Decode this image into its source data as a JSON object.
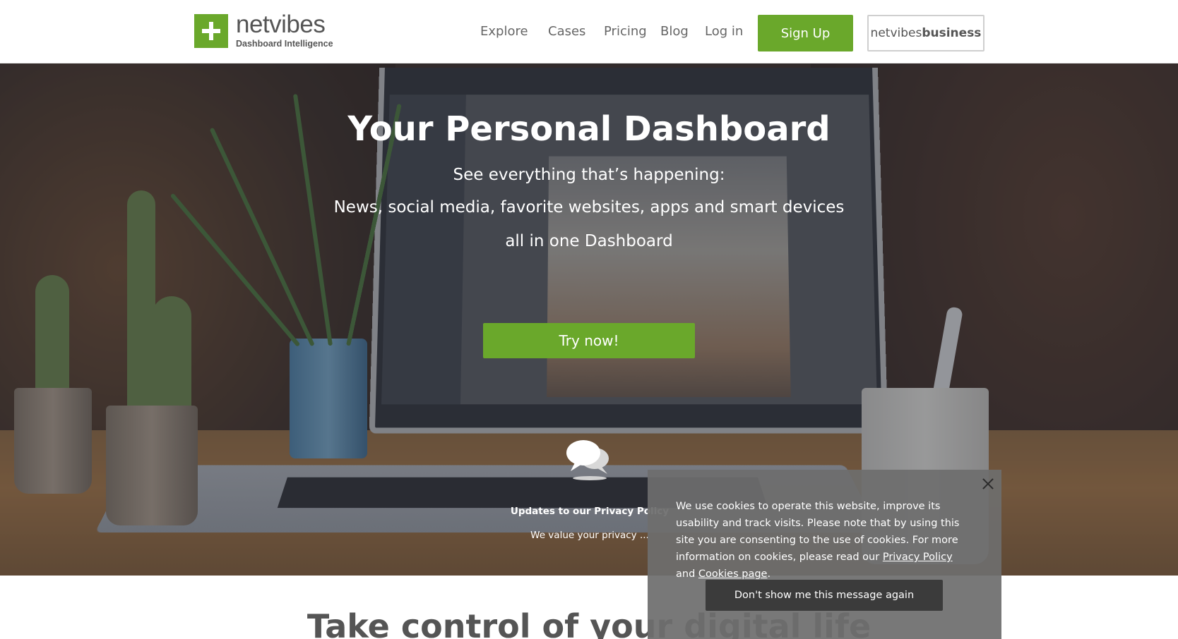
{
  "header": {
    "logo": {
      "name": "netvibes",
      "tagline": "Dashboard Intelligence"
    },
    "nav": [
      {
        "label": "Explore"
      },
      {
        "label": "Cases"
      },
      {
        "label": "Pricing"
      },
      {
        "label": "Blog"
      },
      {
        "label": "Log in"
      }
    ],
    "signup_label": "Sign Up",
    "business": {
      "prefix": "netvibes",
      "bold": "business"
    }
  },
  "hero": {
    "title": "Your Personal Dashboard",
    "subtitle_1": "See everything that’s happening:",
    "subtitle_2": "News, social media, favorite websites, apps and smart devices",
    "subtitle_3": "all in one Dashboard",
    "cta_label": "Try now!",
    "privacy_title": "Updates to our Privacy Policy",
    "privacy_text": "We value your privacy ..."
  },
  "section": {
    "title": "Take control of your digital life"
  },
  "cookie": {
    "text_1": "We use cookies to operate this website, improve its usability and track visits. Please note that by using this site you are consenting to the use of cookies. For more information on cookies, please read our",
    "link_privacy": "Privacy Policy",
    "text_and": "and",
    "link_cookies": "Cookies page",
    "text_end": ".",
    "button_label": "Don't show me this message again"
  },
  "colors": {
    "brand_green": "#6aa82b",
    "cookie_bg": "#6e6e6e",
    "cookie_button": "#3b3b3b"
  },
  "icons": [
    "netvibes-plus-logo-icon",
    "chat-bubbles-icon",
    "close-icon"
  ]
}
